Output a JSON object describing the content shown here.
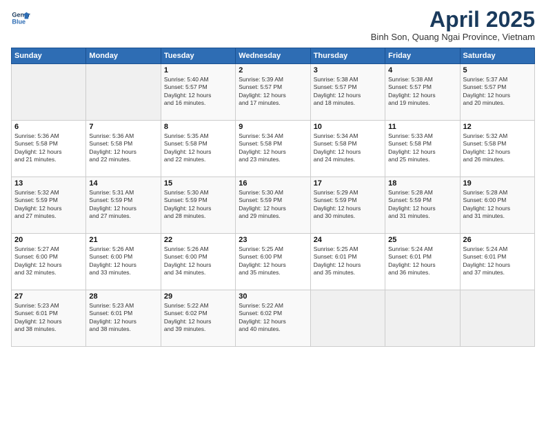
{
  "header": {
    "logo_line1": "General",
    "logo_line2": "Blue",
    "month_title": "April 2025",
    "location": "Binh Son, Quang Ngai Province, Vietnam"
  },
  "weekdays": [
    "Sunday",
    "Monday",
    "Tuesday",
    "Wednesday",
    "Thursday",
    "Friday",
    "Saturday"
  ],
  "weeks": [
    [
      {
        "day": "",
        "info": ""
      },
      {
        "day": "",
        "info": ""
      },
      {
        "day": "1",
        "info": "Sunrise: 5:40 AM\nSunset: 5:57 PM\nDaylight: 12 hours\nand 16 minutes."
      },
      {
        "day": "2",
        "info": "Sunrise: 5:39 AM\nSunset: 5:57 PM\nDaylight: 12 hours\nand 17 minutes."
      },
      {
        "day": "3",
        "info": "Sunrise: 5:38 AM\nSunset: 5:57 PM\nDaylight: 12 hours\nand 18 minutes."
      },
      {
        "day": "4",
        "info": "Sunrise: 5:38 AM\nSunset: 5:57 PM\nDaylight: 12 hours\nand 19 minutes."
      },
      {
        "day": "5",
        "info": "Sunrise: 5:37 AM\nSunset: 5:57 PM\nDaylight: 12 hours\nand 20 minutes."
      }
    ],
    [
      {
        "day": "6",
        "info": "Sunrise: 5:36 AM\nSunset: 5:58 PM\nDaylight: 12 hours\nand 21 minutes."
      },
      {
        "day": "7",
        "info": "Sunrise: 5:36 AM\nSunset: 5:58 PM\nDaylight: 12 hours\nand 22 minutes."
      },
      {
        "day": "8",
        "info": "Sunrise: 5:35 AM\nSunset: 5:58 PM\nDaylight: 12 hours\nand 22 minutes."
      },
      {
        "day": "9",
        "info": "Sunrise: 5:34 AM\nSunset: 5:58 PM\nDaylight: 12 hours\nand 23 minutes."
      },
      {
        "day": "10",
        "info": "Sunrise: 5:34 AM\nSunset: 5:58 PM\nDaylight: 12 hours\nand 24 minutes."
      },
      {
        "day": "11",
        "info": "Sunrise: 5:33 AM\nSunset: 5:58 PM\nDaylight: 12 hours\nand 25 minutes."
      },
      {
        "day": "12",
        "info": "Sunrise: 5:32 AM\nSunset: 5:58 PM\nDaylight: 12 hours\nand 26 minutes."
      }
    ],
    [
      {
        "day": "13",
        "info": "Sunrise: 5:32 AM\nSunset: 5:59 PM\nDaylight: 12 hours\nand 27 minutes."
      },
      {
        "day": "14",
        "info": "Sunrise: 5:31 AM\nSunset: 5:59 PM\nDaylight: 12 hours\nand 27 minutes."
      },
      {
        "day": "15",
        "info": "Sunrise: 5:30 AM\nSunset: 5:59 PM\nDaylight: 12 hours\nand 28 minutes."
      },
      {
        "day": "16",
        "info": "Sunrise: 5:30 AM\nSunset: 5:59 PM\nDaylight: 12 hours\nand 29 minutes."
      },
      {
        "day": "17",
        "info": "Sunrise: 5:29 AM\nSunset: 5:59 PM\nDaylight: 12 hours\nand 30 minutes."
      },
      {
        "day": "18",
        "info": "Sunrise: 5:28 AM\nSunset: 5:59 PM\nDaylight: 12 hours\nand 31 minutes."
      },
      {
        "day": "19",
        "info": "Sunrise: 5:28 AM\nSunset: 6:00 PM\nDaylight: 12 hours\nand 31 minutes."
      }
    ],
    [
      {
        "day": "20",
        "info": "Sunrise: 5:27 AM\nSunset: 6:00 PM\nDaylight: 12 hours\nand 32 minutes."
      },
      {
        "day": "21",
        "info": "Sunrise: 5:26 AM\nSunset: 6:00 PM\nDaylight: 12 hours\nand 33 minutes."
      },
      {
        "day": "22",
        "info": "Sunrise: 5:26 AM\nSunset: 6:00 PM\nDaylight: 12 hours\nand 34 minutes."
      },
      {
        "day": "23",
        "info": "Sunrise: 5:25 AM\nSunset: 6:00 PM\nDaylight: 12 hours\nand 35 minutes."
      },
      {
        "day": "24",
        "info": "Sunrise: 5:25 AM\nSunset: 6:01 PM\nDaylight: 12 hours\nand 35 minutes."
      },
      {
        "day": "25",
        "info": "Sunrise: 5:24 AM\nSunset: 6:01 PM\nDaylight: 12 hours\nand 36 minutes."
      },
      {
        "day": "26",
        "info": "Sunrise: 5:24 AM\nSunset: 6:01 PM\nDaylight: 12 hours\nand 37 minutes."
      }
    ],
    [
      {
        "day": "27",
        "info": "Sunrise: 5:23 AM\nSunset: 6:01 PM\nDaylight: 12 hours\nand 38 minutes."
      },
      {
        "day": "28",
        "info": "Sunrise: 5:23 AM\nSunset: 6:01 PM\nDaylight: 12 hours\nand 38 minutes."
      },
      {
        "day": "29",
        "info": "Sunrise: 5:22 AM\nSunset: 6:02 PM\nDaylight: 12 hours\nand 39 minutes."
      },
      {
        "day": "30",
        "info": "Sunrise: 5:22 AM\nSunset: 6:02 PM\nDaylight: 12 hours\nand 40 minutes."
      },
      {
        "day": "",
        "info": ""
      },
      {
        "day": "",
        "info": ""
      },
      {
        "day": "",
        "info": ""
      }
    ]
  ]
}
